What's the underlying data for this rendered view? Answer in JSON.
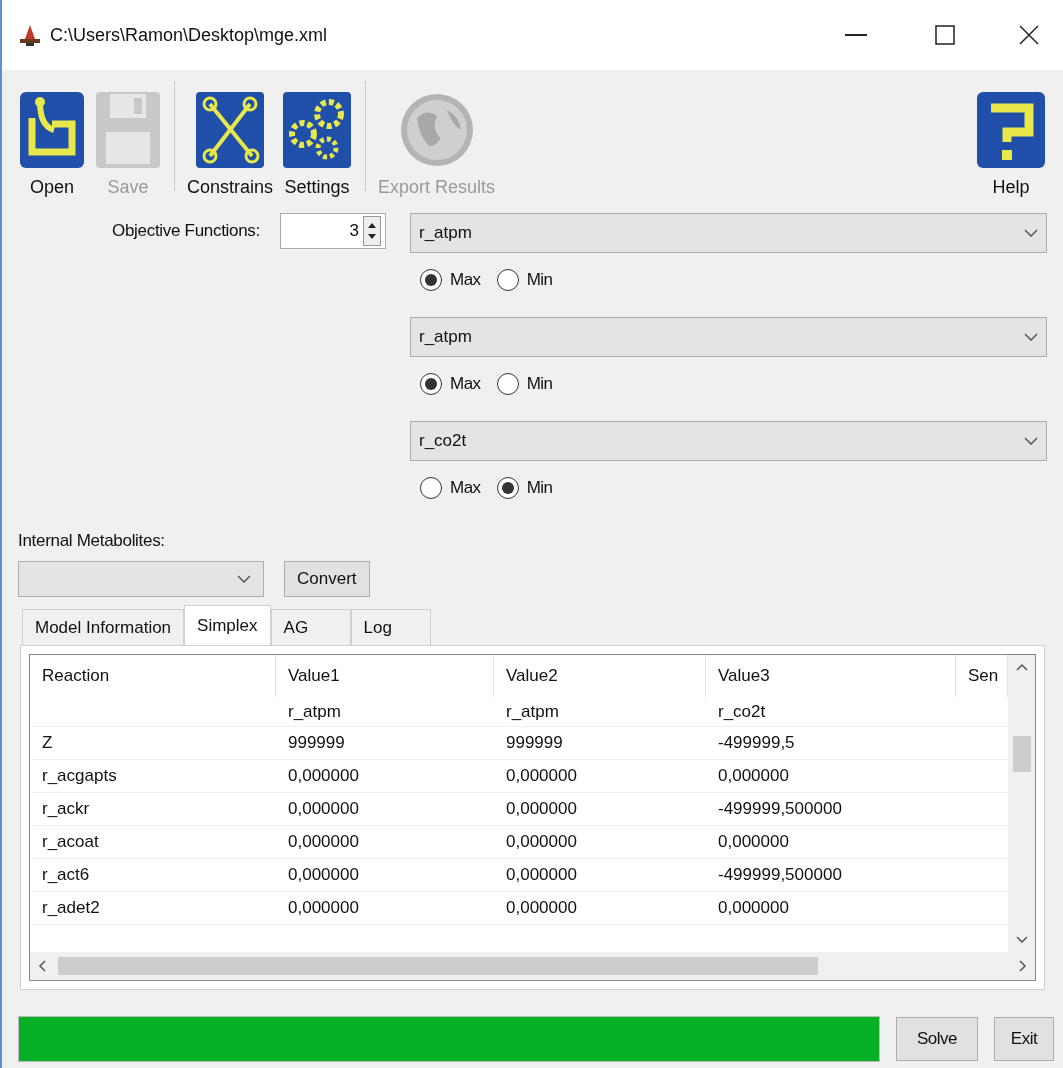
{
  "window": {
    "title": "C:\\Users\\Ramon\\Desktop\\mge.xml"
  },
  "toolbar": [
    {
      "kind": "open",
      "label": "Open",
      "disabled": false
    },
    {
      "kind": "save",
      "label": "Save",
      "disabled": true
    },
    {
      "kind": "constrains",
      "label": "Constrains",
      "disabled": false
    },
    {
      "kind": "settings",
      "label": "Settings",
      "disabled": false
    },
    {
      "kind": "export",
      "label": "Export Results",
      "disabled": true
    },
    {
      "kind": "help",
      "label": "Help",
      "disabled": false
    }
  ],
  "objective_functions": {
    "label": "Objective Functions:",
    "value": "3"
  },
  "objectives": [
    {
      "reaction": "r_atpm",
      "options": [
        {
          "label": "Max",
          "selected": true
        },
        {
          "label": "Min",
          "selected": false
        }
      ]
    },
    {
      "reaction": "r_atpm",
      "options": [
        {
          "label": "Max",
          "selected": true
        },
        {
          "label": "Min",
          "selected": false
        }
      ]
    },
    {
      "reaction": "r_co2t",
      "options": [
        {
          "label": "Max",
          "selected": false
        },
        {
          "label": "Min",
          "selected": true
        }
      ]
    }
  ],
  "internal_metabolites": {
    "label": "Internal Metabolites:",
    "button": "Convert"
  },
  "tabs": [
    {
      "label": "Model Information",
      "selected": false
    },
    {
      "label": "Simplex",
      "selected": true
    },
    {
      "label": "AG",
      "selected": false
    },
    {
      "label": "Log",
      "selected": false
    }
  ],
  "table": {
    "columns": [
      "Reaction",
      "Value1",
      "Value2",
      "Value3",
      "Sen"
    ],
    "subheader": [
      "r_atpm",
      "r_atpm",
      "r_co2t"
    ],
    "rows": [
      [
        "Z",
        "999999",
        "999999",
        "-499999,5"
      ],
      [
        "r_acgapts",
        "0,000000",
        "0,000000",
        "0,000000"
      ],
      [
        "r_ackr",
        "0,000000",
        "0,000000",
        "-499999,500000"
      ],
      [
        "r_acoat",
        "0,000000",
        "0,000000",
        "0,000000"
      ],
      [
        "r_act6",
        "0,000000",
        "0,000000",
        "-499999,500000"
      ],
      [
        "r_adet2",
        "0,000000",
        "0,000000",
        "0,000000"
      ]
    ]
  },
  "progress": {
    "level": 1
  },
  "buttons": [
    "Solve",
    "Exit"
  ]
}
